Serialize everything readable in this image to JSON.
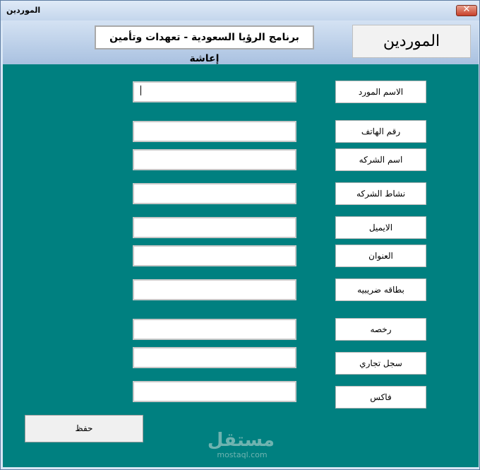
{
  "window": {
    "title": "الموردين",
    "close_glyph": "✕"
  },
  "header": {
    "program_name": "برنامج الرؤيا السعودية - تعهدات وتأمين إعاشة",
    "form_title": "الموردين"
  },
  "fields": [
    {
      "label": "الاسم المورد",
      "value": ""
    },
    {
      "label": "رقم الهاتف",
      "value": ""
    },
    {
      "label": "اسم الشركه",
      "value": ""
    },
    {
      "label": "نشاط الشركه",
      "value": ""
    },
    {
      "label": "الايميل",
      "value": ""
    },
    {
      "label": "العنوان",
      "value": ""
    },
    {
      "label": "بطاقه ضريبيه",
      "value": ""
    },
    {
      "label": "رخصه",
      "value": ""
    },
    {
      "label": "سجل تجاري",
      "value": ""
    },
    {
      "label": "فاكس",
      "value": ""
    }
  ],
  "actions": {
    "save_label": "حفظ"
  },
  "watermark": {
    "main": "مستقل",
    "sub": "mostaql.com"
  }
}
